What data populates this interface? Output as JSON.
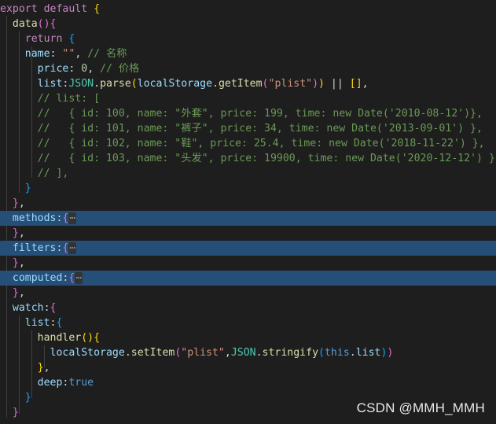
{
  "watermark": "CSDN @MMH_MMH",
  "code": {
    "l1_a": "export",
    "l1_b": "default",
    "l2_a": "data",
    "l3_a": "return",
    "l4_a": "name",
    "l4_b": "\"\"",
    "l4_c": "// 名称",
    "l5_a": "price",
    "l5_b": "0",
    "l5_c": "// 价格",
    "l6_a": "list",
    "l6_b": "JSON",
    "l6_c": "parse",
    "l6_d": "localStorage",
    "l6_e": "getItem",
    "l6_f": "\"plist\"",
    "l7": "// list: [",
    "l8": "//   { id: 100, name: \"外套\", price: 199, time: new Date('2010-08-12')},",
    "l9": "//   { id: 101, name: \"裤子\", price: 34, time: new Date('2013-09-01') },",
    "l10": "//   { id: 102, name: \"鞋\", price: 25.4, time: new Date('2018-11-22') },",
    "l11": "//   { id: 103, name: \"头发\", price: 19900, time: new Date('2020-12-12') }",
    "l12": "// ],",
    "l15": "methods",
    "l17": "filters",
    "l19": "computed",
    "l21": "watch",
    "l22": "list",
    "l23": "handler",
    "l24_a": "localStorage",
    "l24_b": "setItem",
    "l24_c": "\"plist\"",
    "l24_d": "JSON",
    "l24_e": "stringify",
    "l24_f": "this",
    "l24_g": "list",
    "l26_a": "deep",
    "l26_b": "true",
    "ellipsis": "⋯"
  }
}
